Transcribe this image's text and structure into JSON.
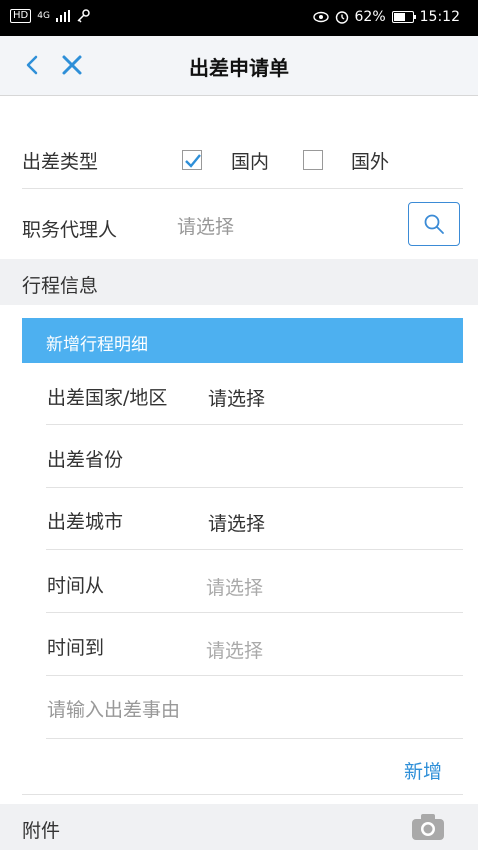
{
  "status_bar": {
    "hd": "HD",
    "network": "4G",
    "battery_percent": "62%",
    "battery_level": 0.62,
    "time": "15:12"
  },
  "nav": {
    "title": "出差申请单"
  },
  "form": {
    "trip_type_label": "出差类型",
    "options": [
      {
        "label": "国内",
        "checked": true
      },
      {
        "label": "国外",
        "checked": false
      }
    ],
    "agent_label": "职务代理人",
    "agent_placeholder": "请选择"
  },
  "itinerary": {
    "section_title": "行程信息",
    "add_detail_label": "新增行程明细",
    "fields": {
      "country_label": "出差国家/地区",
      "country_value": "请选择",
      "province_label": "出差省份",
      "city_label": "出差城市",
      "city_value": "请选择",
      "time_from_label": "时间从",
      "time_from_placeholder": "请选择",
      "time_to_label": "时间到",
      "time_to_placeholder": "请选择",
      "reason_placeholder": "请输入出差事由"
    },
    "new_button": "新增"
  },
  "attachments": {
    "section_title": "附件"
  },
  "colors": {
    "accent": "#3b8bd6",
    "detail_bar": "#4db0f0",
    "link": "#2e8fd8"
  }
}
